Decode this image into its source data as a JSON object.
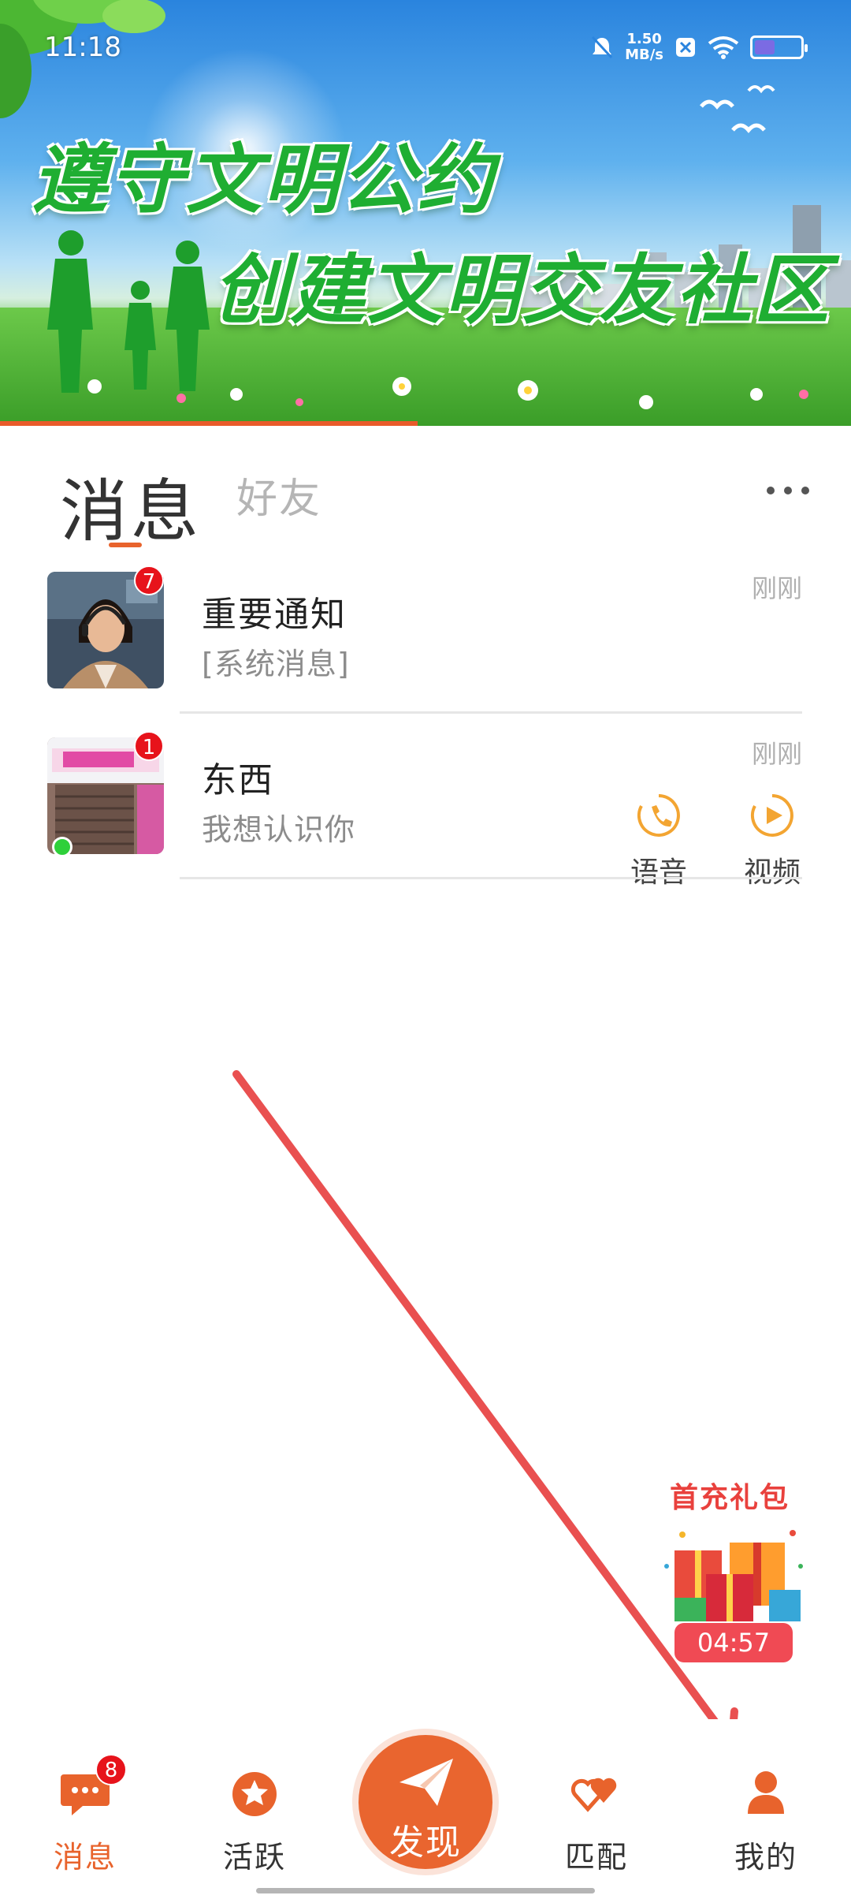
{
  "status_bar": {
    "time": "11:18",
    "network_speed_value": "1.50",
    "network_speed_unit": "MB/s",
    "battery_level_percent": 45
  },
  "banner": {
    "slogan_line1": "遵守文明公约",
    "slogan_line2": "创建文明交友社区"
  },
  "tabs": {
    "messages": "消息",
    "friends": "好友",
    "more_icon": "more-horizontal-icon"
  },
  "conversations": [
    {
      "name": "重要通知",
      "preview": "[系统消息]",
      "time": "刚刚",
      "unread": "7",
      "avatar_icon": "woman-headset-avatar"
    },
    {
      "name": "东西",
      "preview": "我想认识你",
      "time": "刚刚",
      "unread": "1",
      "avatar_icon": "storefront-avatar",
      "online": true,
      "voice_label": "语音",
      "video_label": "视频"
    }
  ],
  "gift_pack": {
    "title": "首充礼包",
    "countdown": "04:57"
  },
  "bottom_nav": {
    "messages": "消息",
    "messages_badge": "8",
    "active": "活跃",
    "discover": "发现",
    "match": "匹配",
    "mine": "我的"
  },
  "colors": {
    "accent": "#e8632c",
    "badge_red": "#e7131b",
    "gift_red": "#e9413d",
    "annotation_arrow": "#e95050"
  }
}
